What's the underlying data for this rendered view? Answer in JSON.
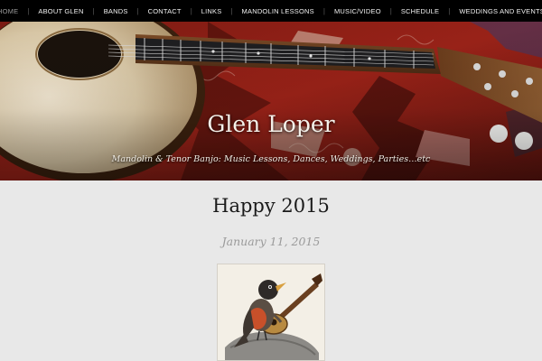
{
  "nav": {
    "items": [
      {
        "label": "HOME"
      },
      {
        "label": "ABOUT GLEN"
      },
      {
        "label": "BANDS"
      },
      {
        "label": "CONTACT"
      },
      {
        "label": "LINKS"
      },
      {
        "label": "MANDOLIN LESSONS"
      },
      {
        "label": "MUSIC/VIDEO"
      },
      {
        "label": "SCHEDULE"
      },
      {
        "label": "WEDDINGS AND EVENTS"
      }
    ],
    "separator": "|",
    "current_index": 0
  },
  "header": {
    "title": "Glen Loper",
    "tagline": "Mandolin & Tenor Banjo: Music Lessons, Dances, Weddings, Parties…etc",
    "image_icon": "mandolin-on-rug-photo"
  },
  "post": {
    "title": "Happy 2015",
    "date": "January 11, 2015",
    "image_icon": "bird-playing-mandolin-illustration"
  },
  "colors": {
    "nav_background": "#000000",
    "nav_text": "#f2f2f2",
    "nav_current": "#9a9a9a",
    "page_background": "#e8e8e8",
    "title_text": "#1a1a1a",
    "date_text": "#9a9a9a"
  }
}
